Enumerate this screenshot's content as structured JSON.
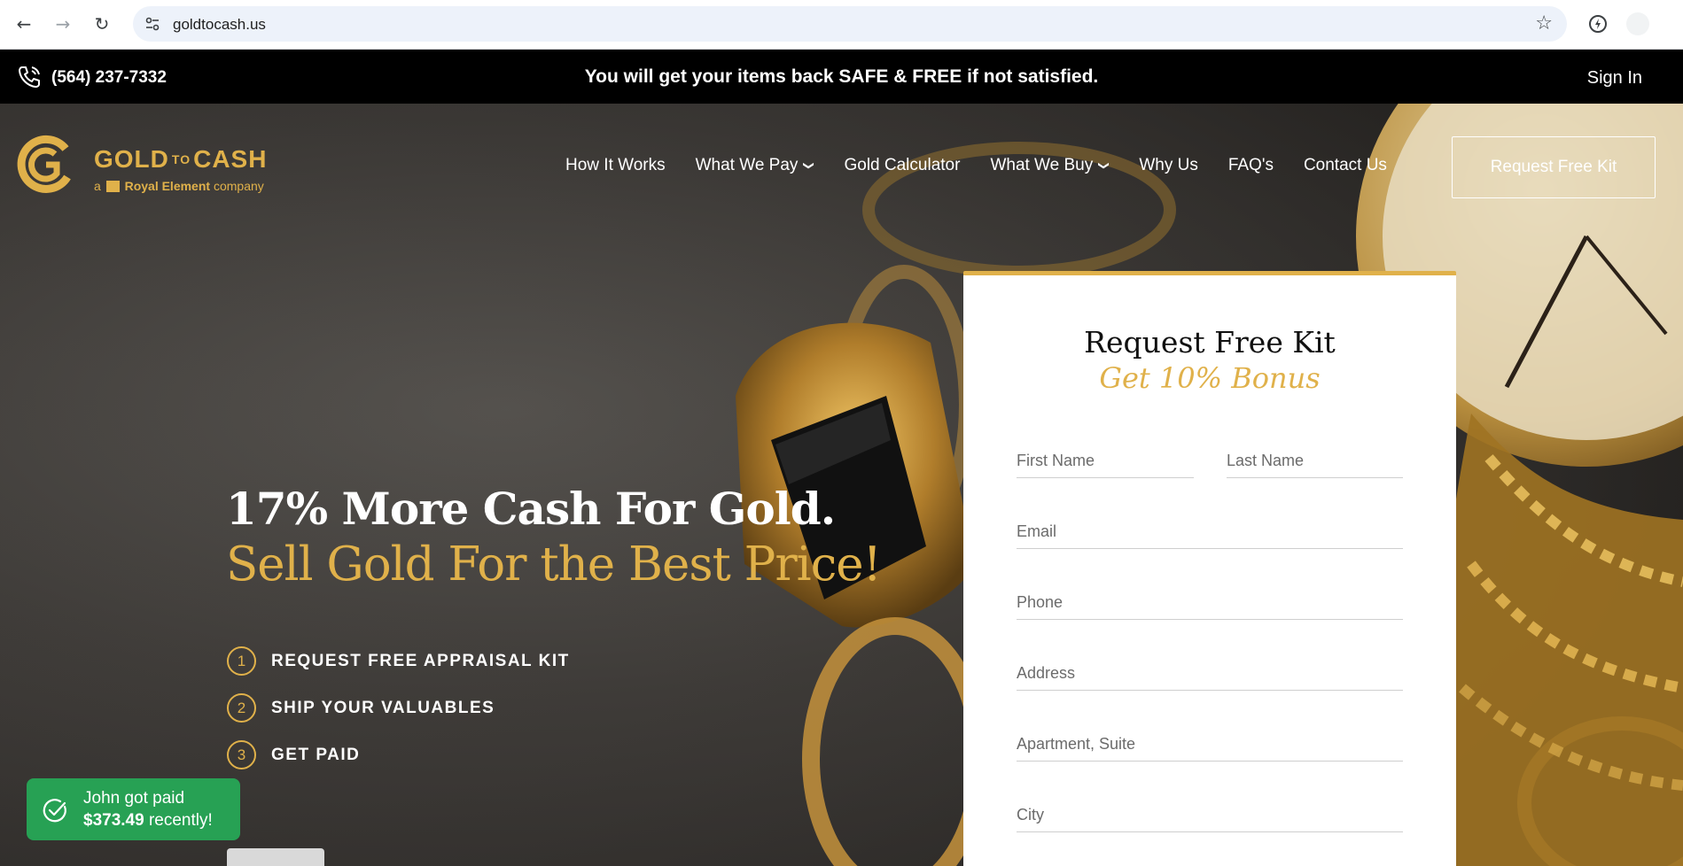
{
  "browser": {
    "url": "goldtocash.us",
    "back_icon": "←",
    "forward_icon": "→",
    "reload_icon": "↻",
    "star_icon": "☆"
  },
  "topbar": {
    "phone": "(564) 237-7332",
    "promo": "You will get your items back SAFE & FREE if not satisfied.",
    "signin": "Sign In"
  },
  "logo": {
    "word_left": "GOLD",
    "word_mid": "TO",
    "word_right": "CASH",
    "sub_prefix": "a",
    "sub_brand": "Royal Element",
    "sub_suffix": "company"
  },
  "nav": {
    "items": [
      {
        "label": "How It Works",
        "dropdown": false
      },
      {
        "label": "What We Pay",
        "dropdown": true
      },
      {
        "label": "Gold Calculator",
        "dropdown": false
      },
      {
        "label": "What We Buy",
        "dropdown": true
      },
      {
        "label": "Why Us",
        "dropdown": false
      },
      {
        "label": "FAQ's",
        "dropdown": false
      },
      {
        "label": "Contact Us",
        "dropdown": false
      }
    ],
    "cta": "Request Free Kit",
    "chevron": "❯"
  },
  "hero": {
    "headline": "17% More Cash For Gold.",
    "subline": "Sell Gold For the Best Price!",
    "steps": [
      {
        "num": "1",
        "label": "REQUEST FREE APPRAISAL KIT"
      },
      {
        "num": "2",
        "label": "SHIP YOUR VALUABLES"
      },
      {
        "num": "3",
        "label": "GET PAID"
      }
    ]
  },
  "toast": {
    "line1": "John got paid",
    "amount": "$373.49",
    "suffix": " recently!"
  },
  "form": {
    "title": "Request Free Kit",
    "bonus": "Get 10% Bonus",
    "first_name": "First Name",
    "last_name": "Last Name",
    "email": "Email",
    "phone": "Phone",
    "address": "Address",
    "apartment": "Apartment, Suite",
    "city": "City"
  },
  "colors": {
    "gold": "#e0b14a",
    "toast_green": "#27a154",
    "topbar": "#000000"
  }
}
